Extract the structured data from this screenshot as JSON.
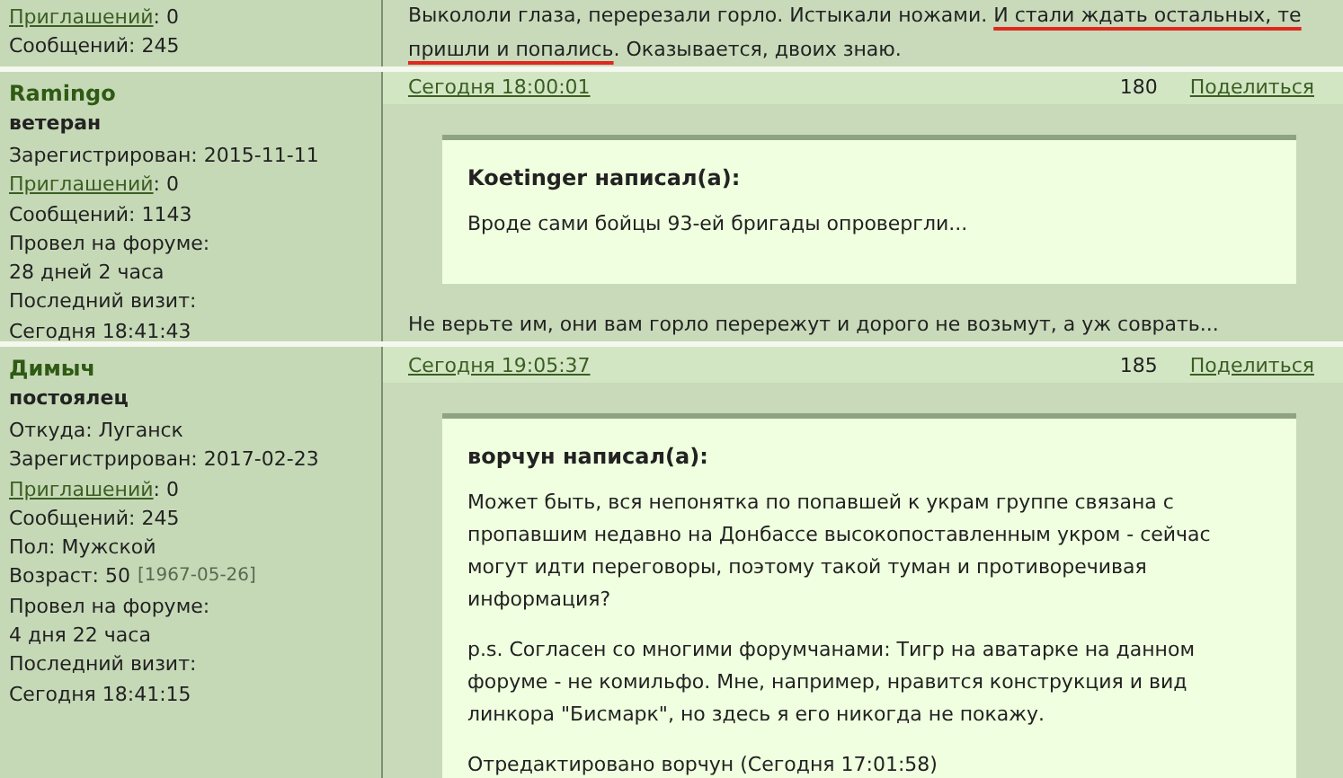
{
  "posts": [
    {
      "author": {
        "lines": [
          {
            "kind": "link",
            "link": "Приглашений",
            "text": ": 0"
          },
          {
            "kind": "plain",
            "text": "Сообщений: 245"
          }
        ]
      },
      "body": [
        {
          "kind": "plain",
          "text": "Выкололи глаза, перерезали горло. Истыкали ножами. "
        },
        {
          "kind": "red_underline",
          "text": "И стали ждать остальных, те пришли и попались"
        },
        {
          "kind": "plain",
          "text": ". Оказывается, двоих знаю."
        }
      ]
    },
    {
      "author": {
        "name": "Ramingo",
        "rank": "ветеран",
        "lines": [
          {
            "kind": "plain",
            "text": "Зарегистрирован: 2015-11-11"
          },
          {
            "kind": "link",
            "link": "Приглашений",
            "text": ": 0"
          },
          {
            "kind": "plain",
            "text": "Сообщений: 1143"
          },
          {
            "kind": "plain",
            "text": "Провел на форуме:"
          },
          {
            "kind": "plain",
            "text": "28 дней 2 часа"
          },
          {
            "kind": "plain",
            "text": "Последний визит:"
          },
          {
            "kind": "plain",
            "text": "Сегодня 18:41:43"
          }
        ]
      },
      "date": "Сегодня 18:00:01",
      "number": "180",
      "share": "Поделиться",
      "quote": {
        "author": "Koetinger написал(а):",
        "paragraphs": [
          "Вроде сами бойцы 93-ей бригады опровергли..."
        ]
      },
      "body": [
        {
          "kind": "plain",
          "text": "Не верьте им, они вам горло перережут и дорого не возьмут, а уж соврать..."
        }
      ]
    },
    {
      "author": {
        "name": "Димыч",
        "rank": "постоялец",
        "lines": [
          {
            "kind": "plain",
            "text": "Откуда: Луганск"
          },
          {
            "kind": "plain",
            "text": "Зарегистрирован: 2017-02-23"
          },
          {
            "kind": "link",
            "link": "Приглашений",
            "text": ": 0"
          },
          {
            "kind": "plain",
            "text": "Сообщений: 245"
          },
          {
            "kind": "plain",
            "text": "Пол: Мужской"
          },
          {
            "kind": "note",
            "text": "Возраст: 50",
            "note": "[1967-05-26]"
          },
          {
            "kind": "plain",
            "text": "Провел на форуме:"
          },
          {
            "kind": "plain",
            "text": "4 дня 22 часа"
          },
          {
            "kind": "plain",
            "text": "Последний визит:"
          },
          {
            "kind": "plain",
            "text": "Сегодня 18:41:15"
          }
        ]
      },
      "date": "Сегодня 19:05:37",
      "number": "185",
      "share": "Поделиться",
      "quote": {
        "author": "ворчун написал(а):",
        "paragraphs": [
          "Может быть, вся непонятка по попавшей к украм группе связана с пропавшим недавно на Донбассе высокопоставленным укром - сейчас могут идти переговоры, поэтому такой туман и противоречивая информация?",
          "p.s. Согласен со многими форумчанами: Тигр на аватарке на данном форуме - не комильфо. Мне, например, нравится конструкция и вид линкора \"Бисмарк\", но здесь я его никогда не покажу.",
          "Отредактировано ворчун (Сегодня 17:01:58)"
        ]
      }
    }
  ]
}
